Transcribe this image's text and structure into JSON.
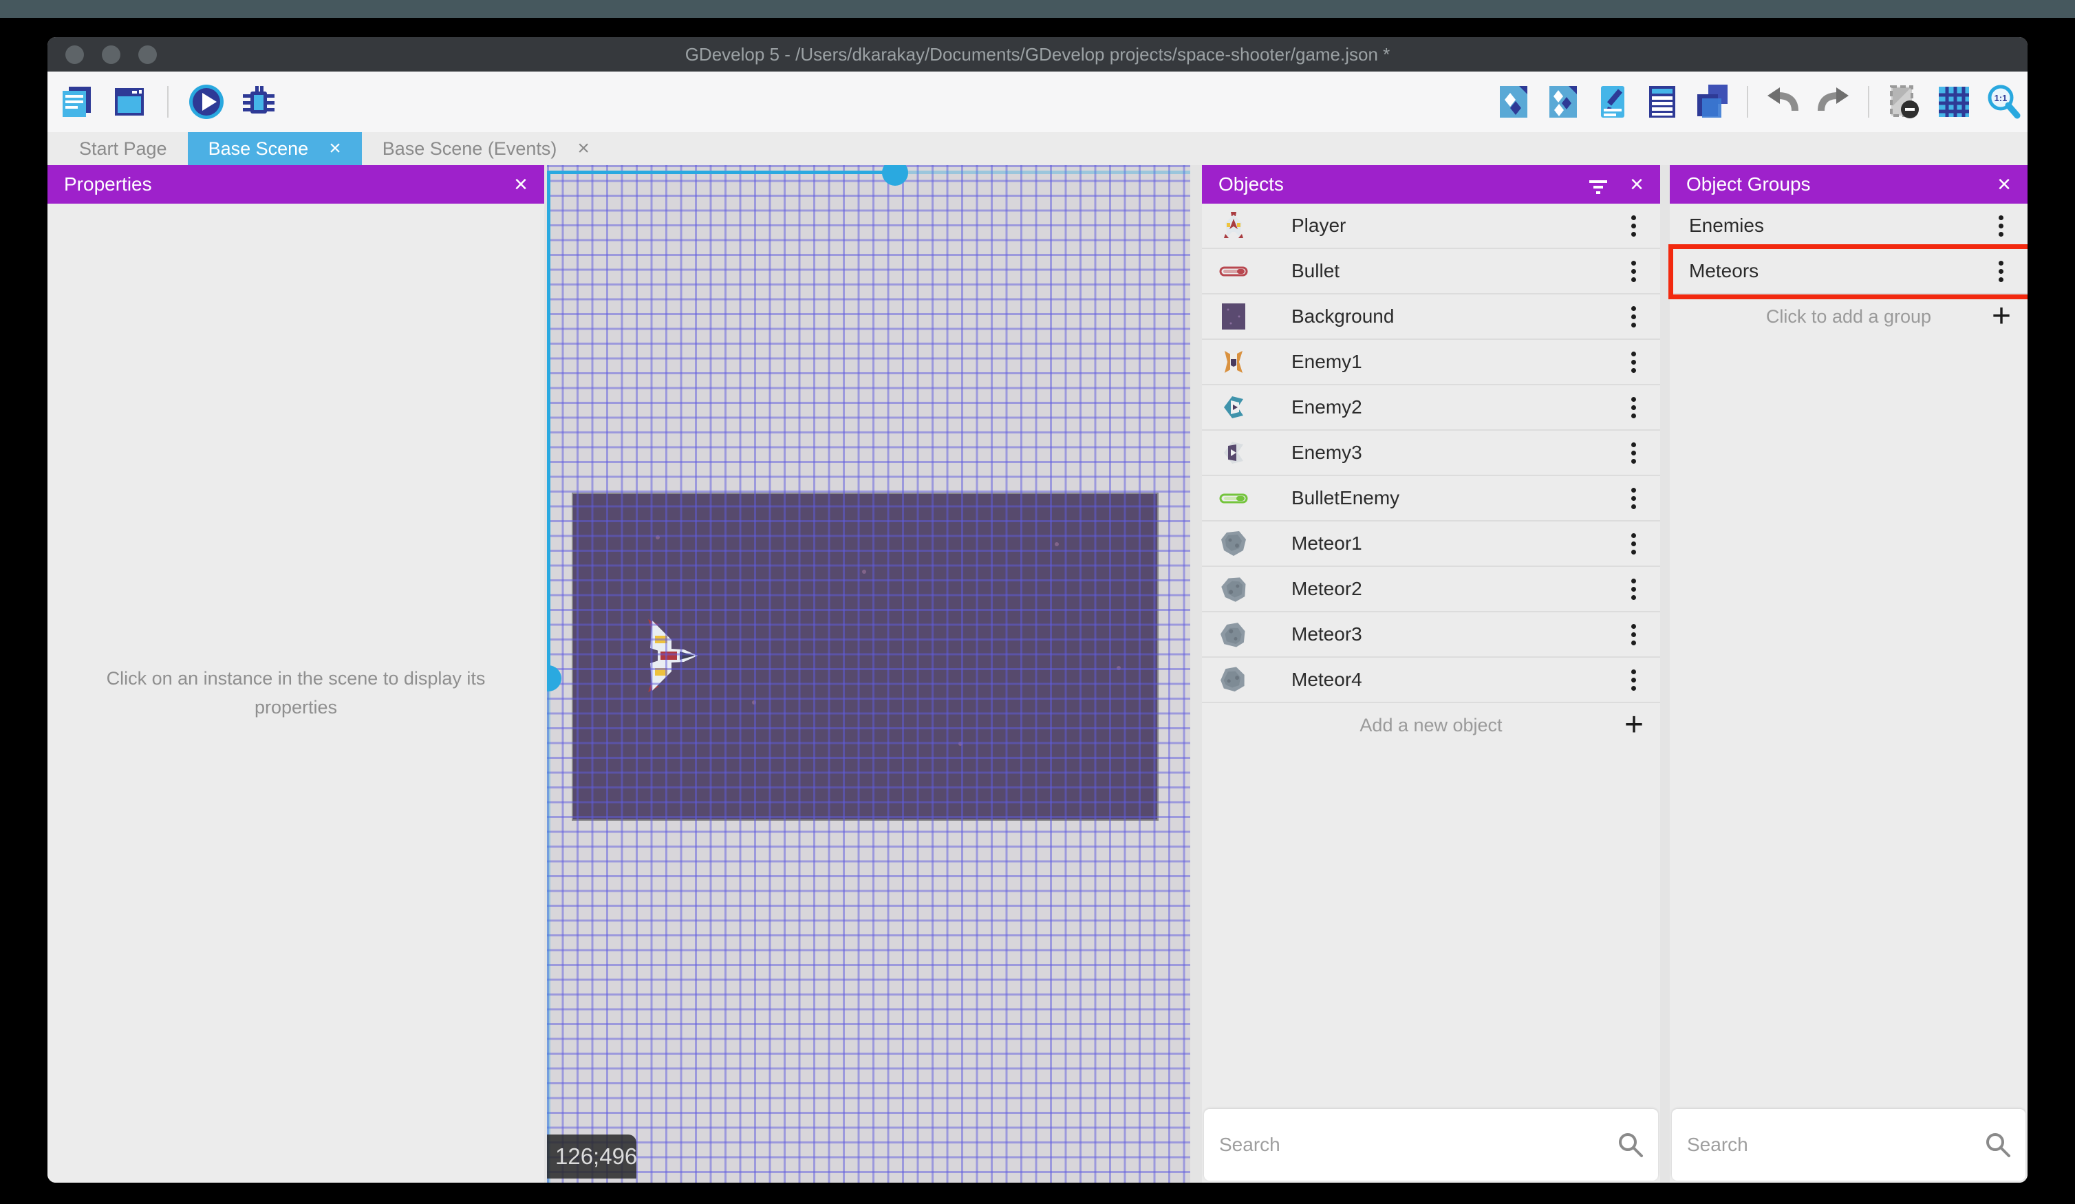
{
  "window": {
    "title": "GDevelop 5 - /Users/dkarakay/Documents/GDevelop projects/space-shooter/game.json *"
  },
  "toolbar": {
    "left": [
      {
        "name": "project-manager-icon"
      },
      {
        "name": "start-page-icon"
      },
      {
        "name": "divider"
      },
      {
        "name": "play-preview-icon"
      },
      {
        "name": "debug-icon"
      }
    ],
    "right": [
      {
        "name": "objects-editor-icon"
      },
      {
        "name": "object-groups-editor-icon"
      },
      {
        "name": "properties-panel-icon"
      },
      {
        "name": "instances-list-icon"
      },
      {
        "name": "layers-panel-icon"
      },
      {
        "name": "divider"
      },
      {
        "name": "undo-icon"
      },
      {
        "name": "redo-icon"
      },
      {
        "name": "divider"
      },
      {
        "name": "window-mask-icon"
      },
      {
        "name": "grid-icon"
      },
      {
        "name": "zoom-reset-icon"
      }
    ]
  },
  "tabs": [
    {
      "label": "Start Page",
      "active": false,
      "closable": false
    },
    {
      "label": "Base Scene",
      "active": true,
      "closable": true
    },
    {
      "label": "Base Scene (Events)",
      "active": false,
      "closable": true
    }
  ],
  "properties_panel": {
    "title": "Properties",
    "empty_message": "Click on an instance in the scene to display its properties"
  },
  "scene": {
    "coordinate_badge": "126;496"
  },
  "objects_panel": {
    "title": "Objects",
    "search_placeholder": "Search",
    "add_label": "Add a new object",
    "items": [
      {
        "label": "Player",
        "icon": "player-ship"
      },
      {
        "label": "Bullet",
        "icon": "bullet-red"
      },
      {
        "label": "Background",
        "icon": "background-square"
      },
      {
        "label": "Enemy1",
        "icon": "enemy-orange"
      },
      {
        "label": "Enemy2",
        "icon": "enemy-teal"
      },
      {
        "label": "Enemy3",
        "icon": "enemy-white"
      },
      {
        "label": "BulletEnemy",
        "icon": "bullet-green"
      },
      {
        "label": "Meteor1",
        "icon": "meteor-a"
      },
      {
        "label": "Meteor2",
        "icon": "meteor-b"
      },
      {
        "label": "Meteor3",
        "icon": "meteor-c"
      },
      {
        "label": "Meteor4",
        "icon": "meteor-d"
      }
    ]
  },
  "groups_panel": {
    "title": "Object Groups",
    "search_placeholder": "Search",
    "add_label": "Click to add a group",
    "items": [
      {
        "label": "Enemies",
        "highlighted": false
      },
      {
        "label": "Meteors",
        "highlighted": true
      }
    ]
  },
  "colors": {
    "accent_purple": "#9e21cb",
    "accent_blue": "#4cb0e4",
    "selection_cyan": "#2aa9e0",
    "highlight_red": "#f2290f",
    "background_instance": "#574a6d"
  }
}
